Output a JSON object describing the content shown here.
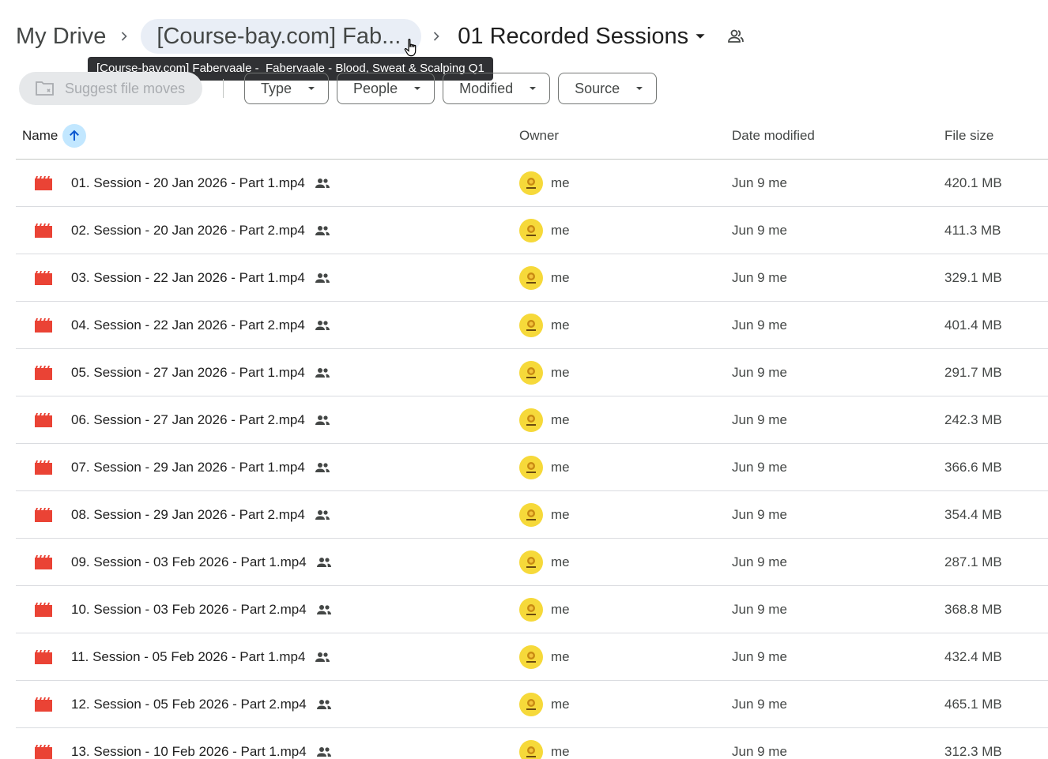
{
  "breadcrumb": {
    "root": "My Drive",
    "middle": "[Course-bay.com] Fab...",
    "current": "01 Recorded Sessions"
  },
  "tooltip": "[Course-bay.com] Fabervaale -  Fabervaale - Blood, Sweat & Scalping Q1",
  "filters": {
    "suggest": "Suggest file moves",
    "chips": [
      "Type",
      "People",
      "Modified",
      "Source"
    ]
  },
  "table": {
    "headers": {
      "name": "Name",
      "owner": "Owner",
      "date": "Date modified",
      "size": "File size"
    },
    "rows": [
      {
        "name": "01. Session - 20 Jan 2026 - Part 1.mp4",
        "owner": "me",
        "date": "Jun 9 me",
        "size": "420.1 MB"
      },
      {
        "name": "02. Session - 20 Jan 2026 - Part 2.mp4",
        "owner": "me",
        "date": "Jun 9 me",
        "size": "411.3 MB"
      },
      {
        "name": "03. Session - 22 Jan 2026 - Part 1.mp4",
        "owner": "me",
        "date": "Jun 9 me",
        "size": "329.1 MB"
      },
      {
        "name": "04. Session - 22 Jan 2026 - Part 2.mp4",
        "owner": "me",
        "date": "Jun 9 me",
        "size": "401.4 MB"
      },
      {
        "name": "05. Session - 27 Jan 2026 - Part 1.mp4",
        "owner": "me",
        "date": "Jun 9 me",
        "size": "291.7 MB"
      },
      {
        "name": "06. Session - 27 Jan 2026 - Part 2.mp4",
        "owner": "me",
        "date": "Jun 9 me",
        "size": "242.3 MB"
      },
      {
        "name": "07. Session - 29 Jan 2026 - Part 1.mp4",
        "owner": "me",
        "date": "Jun 9 me",
        "size": "366.6 MB"
      },
      {
        "name": "08. Session - 29 Jan 2026 - Part 2.mp4",
        "owner": "me",
        "date": "Jun 9 me",
        "size": "354.4 MB"
      },
      {
        "name": "09. Session - 03 Feb 2026 - Part 1.mp4",
        "owner": "me",
        "date": "Jun 9 me",
        "size": "287.1 MB"
      },
      {
        "name": "10. Session - 03 Feb 2026 - Part 2.mp4",
        "owner": "me",
        "date": "Jun 9 me",
        "size": "368.8 MB"
      },
      {
        "name": "11. Session - 05 Feb 2026 - Part 1.mp4",
        "owner": "me",
        "date": "Jun 9 me",
        "size": "432.4 MB"
      },
      {
        "name": "12. Session - 05 Feb 2026 - Part 2.mp4",
        "owner": "me",
        "date": "Jun 9 me",
        "size": "465.1 MB"
      },
      {
        "name": "13. Session - 10 Feb 2026 - Part 1.mp4",
        "owner": "me",
        "date": "Jun 9 me",
        "size": "312.3 MB"
      }
    ]
  },
  "colors": {
    "video_icon": "#ea4335",
    "sort_accent": "#c2e7ff",
    "avatar": "#f6d93a"
  },
  "icons": {
    "file": "video-file-icon",
    "shared": "shared-people-icon",
    "sort": "arrow-up-icon",
    "folder_share": "shared-folder-icon",
    "suggest": "folder-move-icon"
  }
}
